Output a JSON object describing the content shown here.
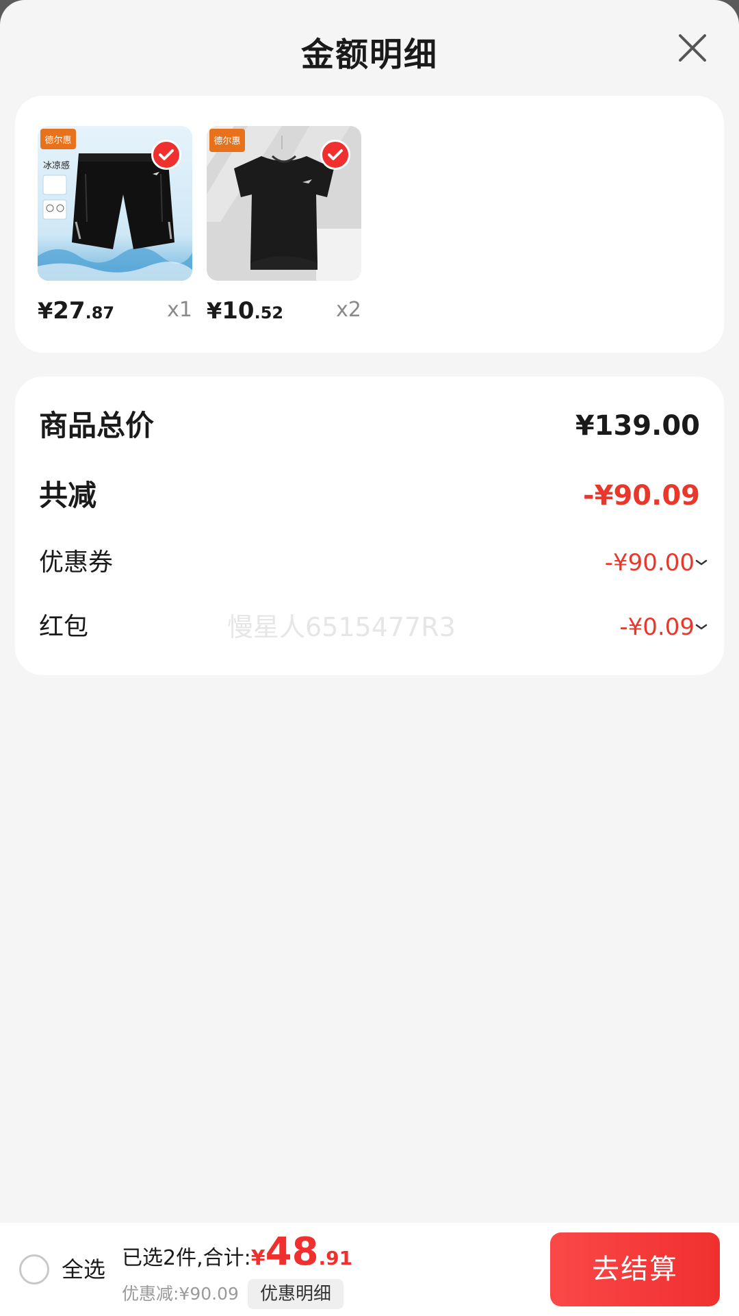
{
  "header": {
    "title": "金额明细"
  },
  "products": [
    {
      "name": "shorts",
      "logo_text": "德尔惠",
      "image_badge": "冰凉感",
      "price_currency": "¥",
      "price_int": "27",
      "price_dec": ".87",
      "qty": "x1"
    },
    {
      "name": "tshirt",
      "logo_text": "德尔惠",
      "price_currency": "¥",
      "price_int": "10",
      "price_dec": ".52",
      "qty": "x2"
    }
  ],
  "summary": {
    "total_label": "商品总价",
    "total_value": "¥139.00",
    "reduce_label": "共减",
    "reduce_value": "-¥90.09",
    "coupon_label": "优惠券",
    "coupon_value": "-¥90.00",
    "redpacket_label": "红包",
    "redpacket_value": "-¥0.09",
    "watermark": "慢星人6515477R3"
  },
  "bottom": {
    "select_all": "全选",
    "selected_text": "已选2件,合计:",
    "total_currency": "¥",
    "total_int": "48",
    "total_dec": ".91",
    "discount_text": "优惠减:¥90.09",
    "detail_button": "优惠明细",
    "checkout": "去结算"
  },
  "colors": {
    "accent": "#f0302e",
    "discount_red": "#e8372b",
    "background": "#f5f5f5"
  }
}
